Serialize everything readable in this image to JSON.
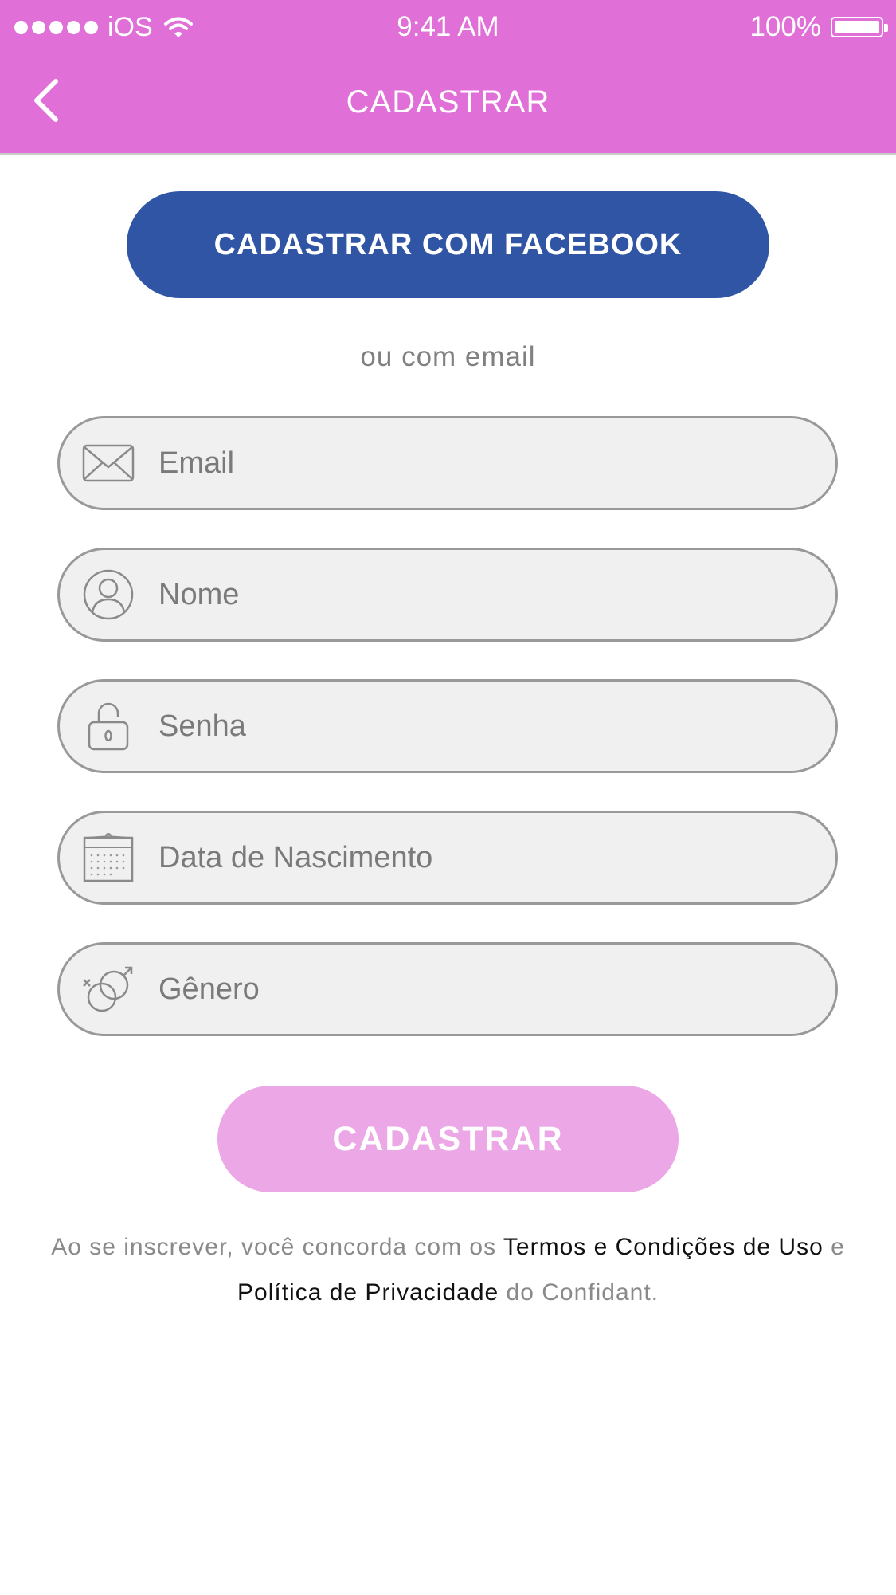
{
  "status_bar": {
    "carrier": "iOS",
    "time": "9:41 AM",
    "battery": "100%"
  },
  "nav": {
    "title": "CADASTRAR"
  },
  "facebook_button": {
    "label": "CADASTRAR COM FACEBOOK"
  },
  "divider_text": "ou com email",
  "fields": [
    {
      "placeholder": "Email",
      "icon": "envelope-icon"
    },
    {
      "placeholder": "Nome",
      "icon": "user-icon"
    },
    {
      "placeholder": "Senha",
      "icon": "lock-icon"
    },
    {
      "placeholder": "Data de Nascimento",
      "icon": "calendar-icon"
    },
    {
      "placeholder": "Gênero",
      "icon": "gender-icon"
    }
  ],
  "submit_button": {
    "label": "CADASTRAR"
  },
  "terms": {
    "prefix": "Ao se inscrever, você concorda com os ",
    "terms_link": "Termos e Condições de Uso",
    "connector": " e ",
    "privacy_link": "Política de Privacidade",
    "suffix": " do Confidant."
  },
  "colors": {
    "header": "#e070d8",
    "facebook": "#2f55a4",
    "submit": "#eca7e6",
    "field_bg": "#f0f0f0",
    "field_border": "#999999"
  }
}
